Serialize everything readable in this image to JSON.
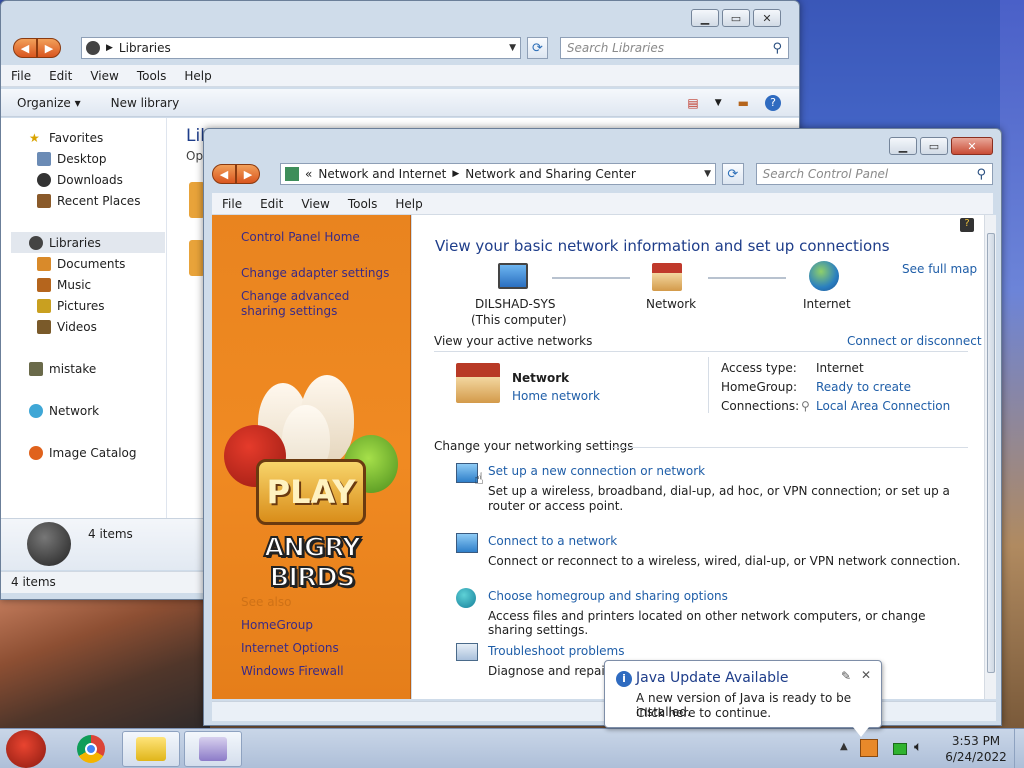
{
  "lib": {
    "address": "Libraries",
    "search_placeholder": "Search Libraries",
    "menu": [
      "File",
      "Edit",
      "View",
      "Tools",
      "Help"
    ],
    "organize": "Organize",
    "new_library": "New library",
    "nav": {
      "favorites": "Favorites",
      "desktop": "Desktop",
      "downloads": "Downloads",
      "recent": "Recent Places",
      "libraries": "Libraries",
      "documents": "Documents",
      "music": "Music",
      "pictures": "Pictures",
      "videos": "Videos",
      "mistake": "mistake",
      "network": "Network",
      "image_catalog": "Image Catalog"
    },
    "main_title": "Libr",
    "main_sub": "Op",
    "details_count": "4 items",
    "status": "4 items"
  },
  "net": {
    "breadcrumb_sep": "«",
    "crumb1": "Network and Internet",
    "crumb2": "Network and Sharing Center",
    "search_placeholder": "Search Control Panel",
    "menu": [
      "File",
      "Edit",
      "View",
      "Tools",
      "Help"
    ],
    "left": {
      "home": "Control Panel Home",
      "adapter": "Change adapter settings",
      "advanced": "Change advanced sharing settings",
      "see_also": "See also",
      "homegroup": "HomeGroup",
      "internet_options": "Internet Options",
      "firewall": "Windows Firewall",
      "ad_top": "PLAY",
      "ad_bottom": "ANGRY BIRDS"
    },
    "title": "View your basic network information and set up connections",
    "see_full_map": "See full map",
    "computer": "DILSHAD-SYS",
    "computer_sub": "(This computer)",
    "network_node": "Network",
    "internet_node": "Internet",
    "active_networks": "View your active networks",
    "connect_disconnect": "Connect or disconnect",
    "network_name": "Network",
    "network_type": "Home network",
    "access_label": "Access type:",
    "access_value": "Internet",
    "homegroup_label": "HomeGroup:",
    "homegroup_value": "Ready to create",
    "connections_label": "Connections:",
    "connections_value": "Local Area Connection",
    "change_settings": "Change your networking settings",
    "tasks": [
      {
        "title": "Set up a new connection or network",
        "desc": "Set up a wireless, broadband, dial-up, ad hoc, or VPN connection; or set up a router or access point."
      },
      {
        "title": "Connect to a network",
        "desc": "Connect or reconnect to a wireless, wired, dial-up, or VPN network connection."
      },
      {
        "title": "Choose homegroup and sharing options",
        "desc": "Access files and printers located on other network computers, or change sharing settings."
      },
      {
        "title": "Troubleshoot problems",
        "desc": "Diagnose and repair n"
      }
    ]
  },
  "balloon": {
    "title": "Java Update Available",
    "line1": "A new version of Java is ready to be installed.",
    "line2": "Click here to continue."
  },
  "tray": {
    "time": "3:53 PM",
    "date": "6/24/2022"
  }
}
